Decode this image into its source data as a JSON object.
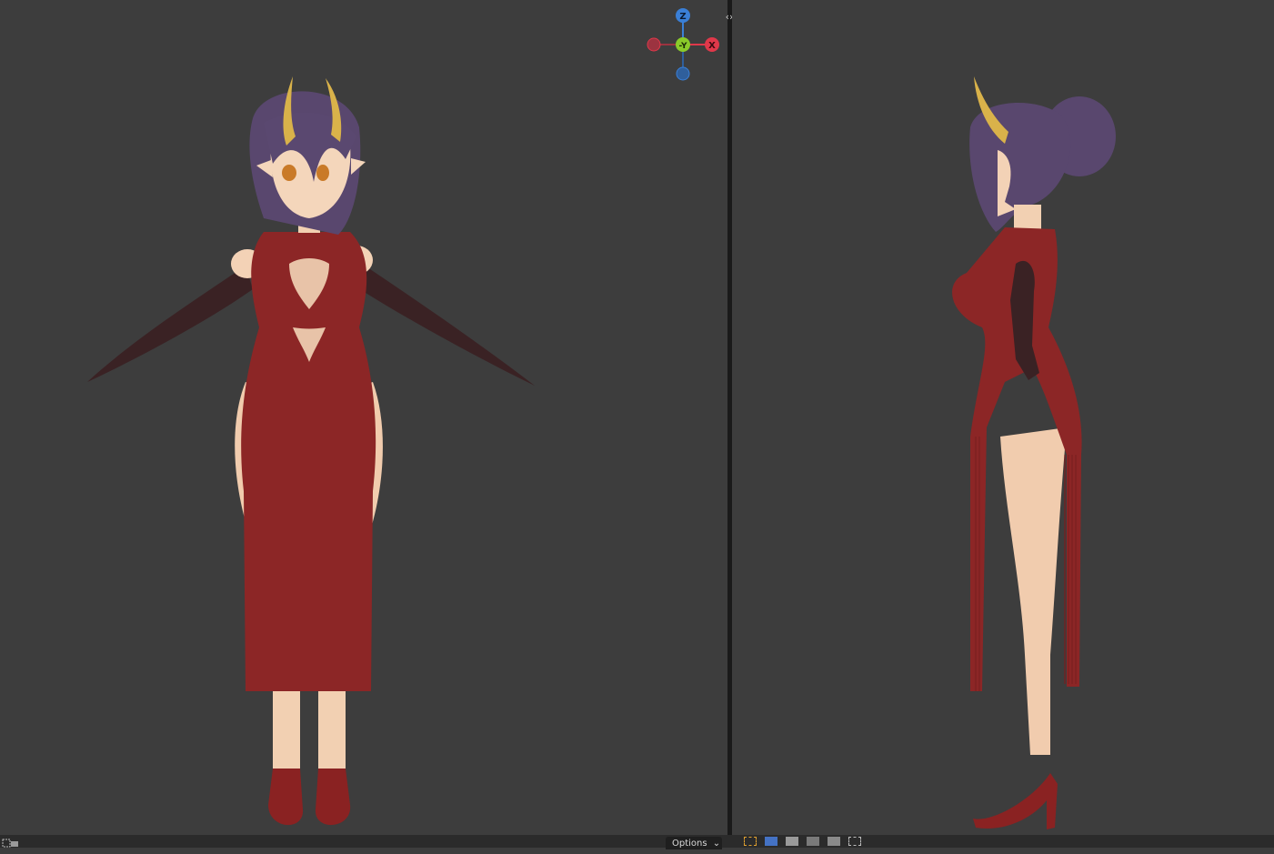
{
  "viewports": {
    "left": {
      "view": "front"
    },
    "right": {
      "view": "side"
    }
  },
  "gizmo": {
    "z_label": "Z",
    "y_label": "-Y",
    "x_label": "X",
    "colors": {
      "z": "#3a7fd6",
      "y": "#8acb2a",
      "x": "#e0384a",
      "neg_x": "#9c3340",
      "neg_z": "#2f5f9c"
    }
  },
  "splitter": {
    "label": "‹›"
  },
  "footer": {
    "options_label": "Options",
    "options_chevron": "⌄"
  },
  "icons": {
    "splitter": "split-arrows-icon",
    "bottom_left": "select-box-icon",
    "tools": [
      "cursor-select-icon",
      "select-new-icon",
      "select-extend-icon",
      "select-subtract-icon",
      "select-invert-icon",
      "select-intersect-icon"
    ]
  },
  "colors": {
    "viewport_bg": "#3d3d3d",
    "dress": "#8b2525",
    "skin": "#f3d2b6",
    "hair": "#59476e",
    "horn": "#d9b24a",
    "glove": "#3a2020"
  }
}
